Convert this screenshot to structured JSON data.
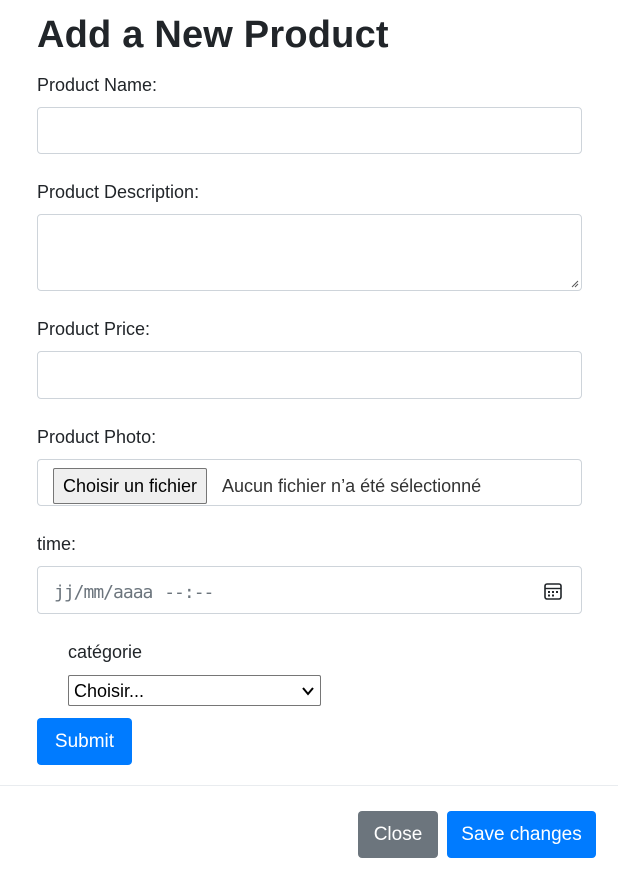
{
  "form": {
    "title": "Add a New Product",
    "name_label": "Product Name:",
    "name_value": "",
    "description_label": "Product Description:",
    "description_value": "",
    "price_label": "Product Price:",
    "price_value": "",
    "photo_label": "Product Photo:",
    "file_button_label": "Choisir un fichier",
    "file_status": "Aucun fichier n’a été sélectionné",
    "time_label": "time:",
    "time_placeholder": "jj/mm/aaaa --:--",
    "category_label": "catégorie",
    "category_selected": "Choisir...",
    "submit_label": "Submit"
  },
  "footer": {
    "close_label": "Close",
    "save_label": "Save changes"
  },
  "colors": {
    "primary": "#007bff",
    "secondary": "#6c757d",
    "border": "#ced4da",
    "text": "#212529"
  },
  "icons": {
    "calendar": "calendar-icon",
    "select_arrow": "chevron-down-icon",
    "resize": "resize-grip-icon"
  }
}
